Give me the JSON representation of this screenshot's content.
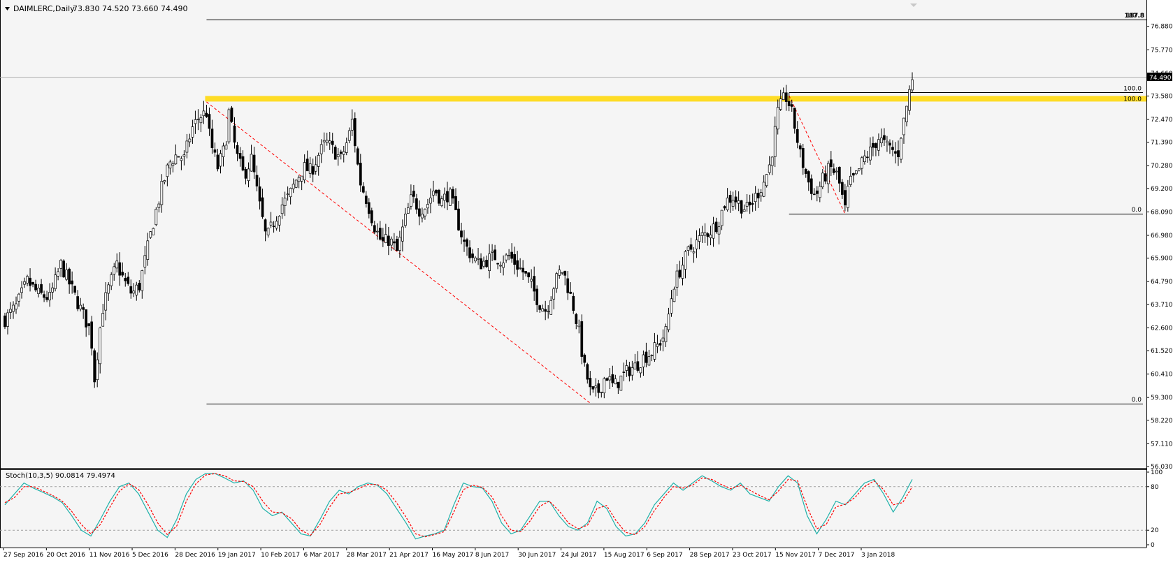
{
  "header": {
    "symbol_line": "DAIMLERC,Daily",
    "ohlc": "73.830 74.520 73.660 74.490"
  },
  "main_panel": {
    "price_ticks": [
      "76.880",
      "75.770",
      "74.660",
      "73.580",
      "72.470",
      "71.390",
      "70.280",
      "69.200",
      "68.090",
      "66.980",
      "65.900",
      "64.790",
      "63.710",
      "62.600",
      "61.520",
      "60.410",
      "59.300",
      "58.220",
      "57.110",
      "56.030"
    ],
    "current_price_label": "74.490",
    "top_right_label": "187.8",
    "fib_labels": [
      "100.0",
      "100.0",
      "0.0",
      "0.0"
    ]
  },
  "stoch_panel": {
    "label": "Stoch(10,3,5) 90.0814 79.4974",
    "ticks": [
      "100",
      "80",
      "20",
      "0"
    ]
  },
  "time_axis": {
    "labels": [
      "27 Sep 2016",
      "20 Oct 2016",
      "11 Nov 2016",
      "5 Dec 2016",
      "28 Dec 2016",
      "19 Jan 2017",
      "10 Feb 2017",
      "6 Mar 2017",
      "28 Mar 2017",
      "21 Apr 2017",
      "16 May 2017",
      "8 Jun 2017",
      "30 Jun 2017",
      "24 Jul 2017",
      "15 Aug 2017",
      "6 Sep 2017",
      "28 Sep 2017",
      "23 Oct 2017",
      "15 Nov 2017",
      "7 Dec 2017",
      "3 Jan 2018"
    ]
  },
  "colors": {
    "background": "#f5f5f5",
    "bull_candle": "#ffffff",
    "bear_candle": "#000000",
    "resistance_band": "#ffd700",
    "trend_line": "#ff0000",
    "stoch_main": "#20b2aa",
    "stoch_signal": "#ff0000"
  },
  "chart_data": [
    {
      "type": "candlestick",
      "series": [
        {
          "name": "DAIMLERC",
          "close_path": [
            [
              0,
              63.0
            ],
            [
              6,
              63.6
            ],
            [
              12,
              64.8
            ],
            [
              18,
              64.2
            ],
            [
              24,
              64.0
            ],
            [
              30,
              65.6
            ],
            [
              36,
              64.4
            ],
            [
              42,
              63.2
            ],
            [
              46,
              62.4
            ],
            [
              48,
              60.2
            ],
            [
              52,
              63.4
            ],
            [
              56,
              64.6
            ],
            [
              60,
              65.6
            ],
            [
              64,
              64.8
            ],
            [
              68,
              64.2
            ],
            [
              72,
              64.6
            ],
            [
              76,
              66.2
            ],
            [
              80,
              67.8
            ],
            [
              84,
              69.2
            ],
            [
              88,
              70.4
            ],
            [
              92,
              70.8
            ],
            [
              96,
              70.6
            ],
            [
              100,
              72.0
            ],
            [
              104,
              72.6
            ],
            [
              108,
              72.8
            ],
            [
              110,
              71.4
            ],
            [
              114,
              70.2
            ],
            [
              118,
              71.2
            ],
            [
              120,
              72.8
            ],
            [
              124,
              70.8
            ],
            [
              128,
              69.8
            ],
            [
              132,
              70.6
            ],
            [
              136,
              68.6
            ],
            [
              140,
              66.8
            ],
            [
              144,
              67.6
            ],
            [
              148,
              68.4
            ],
            [
              152,
              68.8
            ],
            [
              156,
              69.6
            ],
            [
              160,
              70.2
            ],
            [
              164,
              70.0
            ],
            [
              168,
              70.8
            ],
            [
              172,
              71.4
            ],
            [
              176,
              71.0
            ],
            [
              180,
              70.6
            ],
            [
              184,
              71.6
            ],
            [
              186,
              72.4
            ],
            [
              190,
              69.6
            ],
            [
              194,
              68.6
            ],
            [
              198,
              67.4
            ],
            [
              202,
              66.6
            ],
            [
              206,
              66.8
            ],
            [
              210,
              66.2
            ],
            [
              214,
              67.6
            ],
            [
              218,
              68.8
            ],
            [
              222,
              68.2
            ],
            [
              226,
              68.4
            ],
            [
              230,
              69.2
            ],
            [
              234,
              68.6
            ],
            [
              238,
              69.0
            ],
            [
              242,
              67.8
            ],
            [
              246,
              66.6
            ],
            [
              250,
              66.0
            ],
            [
              254,
              65.6
            ],
            [
              258,
              65.8
            ],
            [
              262,
              66.0
            ],
            [
              266,
              65.8
            ],
            [
              270,
              66.0
            ],
            [
              274,
              65.6
            ],
            [
              278,
              65.2
            ],
            [
              282,
              64.6
            ],
            [
              286,
              63.8
            ],
            [
              290,
              63.4
            ],
            [
              294,
              64.6
            ],
            [
              298,
              65.4
            ],
            [
              300,
              65.0
            ],
            [
              304,
              63.8
            ],
            [
              308,
              62.2
            ],
            [
              310,
              60.8
            ],
            [
              312,
              60.2
            ],
            [
              314,
              59.4
            ],
            [
              318,
              59.6
            ],
            [
              322,
              60.4
            ],
            [
              326,
              59.8
            ],
            [
              330,
              60.2
            ],
            [
              334,
              60.6
            ],
            [
              338,
              60.8
            ],
            [
              342,
              61.2
            ],
            [
              346,
              61.4
            ],
            [
              350,
              61.8
            ],
            [
              354,
              62.4
            ],
            [
              358,
              64.6
            ],
            [
              362,
              65.4
            ],
            [
              366,
              66.2
            ],
            [
              370,
              66.6
            ],
            [
              374,
              67.0
            ],
            [
              378,
              67.2
            ],
            [
              382,
              67.6
            ],
            [
              386,
              68.6
            ],
            [
              390,
              68.8
            ],
            [
              394,
              68.4
            ],
            [
              398,
              68.2
            ],
            [
              402,
              68.8
            ],
            [
              406,
              69.4
            ],
            [
              410,
              70.4
            ],
            [
              414,
              72.8
            ],
            [
              418,
              73.6
            ],
            [
              420,
              73.2
            ],
            [
              422,
              72.6
            ],
            [
              426,
              70.8
            ],
            [
              430,
              69.6
            ],
            [
              434,
              68.8
            ],
            [
              438,
              69.6
            ],
            [
              442,
              70.2
            ],
            [
              446,
              69.8
            ],
            [
              450,
              68.2
            ],
            [
              452,
              69.4
            ],
            [
              456,
              69.8
            ],
            [
              460,
              70.6
            ],
            [
              464,
              71.0
            ],
            [
              468,
              71.6
            ],
            [
              472,
              71.2
            ],
            [
              476,
              71.0
            ],
            [
              478,
              70.6
            ],
            [
              480,
              71.8
            ],
            [
              482,
              72.6
            ],
            [
              484,
              73.6
            ],
            [
              486,
              74.49
            ]
          ]
        }
      ],
      "x_start_label": "27 Sep 2016",
      "x_end_label": "3 Jan 2018",
      "ylim": [
        56.03,
        77.4
      ],
      "grid": false,
      "annotations": [
        {
          "type": "horizontal-band",
          "y": 73.45,
          "label": ""
        },
        {
          "type": "horizontal-line",
          "y": 59.0,
          "label": "0.0"
        },
        {
          "type": "horizontal-line",
          "y": 77.2,
          "label": "187.8"
        },
        {
          "type": "horizontal-line",
          "y": 68.0,
          "label": "0.0"
        },
        {
          "type": "horizontal-line",
          "y": 73.75,
          "label": "100.0"
        },
        {
          "type": "trend-line",
          "from": [
            108,
            73.3
          ],
          "to": [
            314,
            59.0
          ]
        },
        {
          "type": "trend-line",
          "from": [
            420,
            73.6
          ],
          "to": [
            450,
            68.0
          ]
        }
      ]
    },
    {
      "type": "line",
      "title": "Stoch(10,3,5) 90.0814 79.4974",
      "ylim": [
        0,
        100
      ],
      "levels": [
        80,
        20
      ],
      "series": [
        {
          "name": "main",
          "values": [
            55,
            70,
            85,
            78,
            72,
            66,
            58,
            40,
            20,
            12,
            35,
            60,
            80,
            85,
            70,
            45,
            20,
            10,
            35,
            70,
            90,
            98,
            98,
            92,
            85,
            88,
            75,
            50,
            40,
            45,
            30,
            15,
            12,
            35,
            60,
            75,
            70,
            80,
            85,
            82,
            70,
            50,
            30,
            8,
            12,
            15,
            20,
            55,
            85,
            80,
            78,
            60,
            30,
            15,
            20,
            40,
            60,
            60,
            40,
            25,
            20,
            30,
            60,
            50,
            25,
            12,
            15,
            30,
            55,
            70,
            85,
            75,
            85,
            95,
            88,
            80,
            75,
            85,
            70,
            65,
            60,
            80,
            95,
            85,
            40,
            15,
            35,
            60,
            55,
            70,
            85,
            90,
            70,
            45,
            65,
            90
          ]
        },
        {
          "name": "signal",
          "values": [
            58,
            65,
            80,
            80,
            74,
            68,
            60,
            46,
            28,
            15,
            28,
            52,
            74,
            84,
            76,
            55,
            30,
            14,
            26,
            60,
            84,
            96,
            98,
            95,
            88,
            87,
            80,
            60,
            45,
            44,
            36,
            20,
            13,
            28,
            52,
            70,
            72,
            77,
            83,
            83,
            75,
            58,
            38,
            15,
            11,
            14,
            18,
            45,
            76,
            82,
            79,
            66,
            40,
            20,
            18,
            33,
            53,
            60,
            47,
            30,
            22,
            27,
            50,
            54,
            33,
            17,
            14,
            25,
            47,
            65,
            80,
            78,
            82,
            92,
            90,
            83,
            77,
            82,
            75,
            68,
            62,
            74,
            90,
            88,
            52,
            22,
            28,
            52,
            56,
            65,
            80,
            88,
            76,
            55,
            58,
            80
          ]
        }
      ]
    }
  ]
}
